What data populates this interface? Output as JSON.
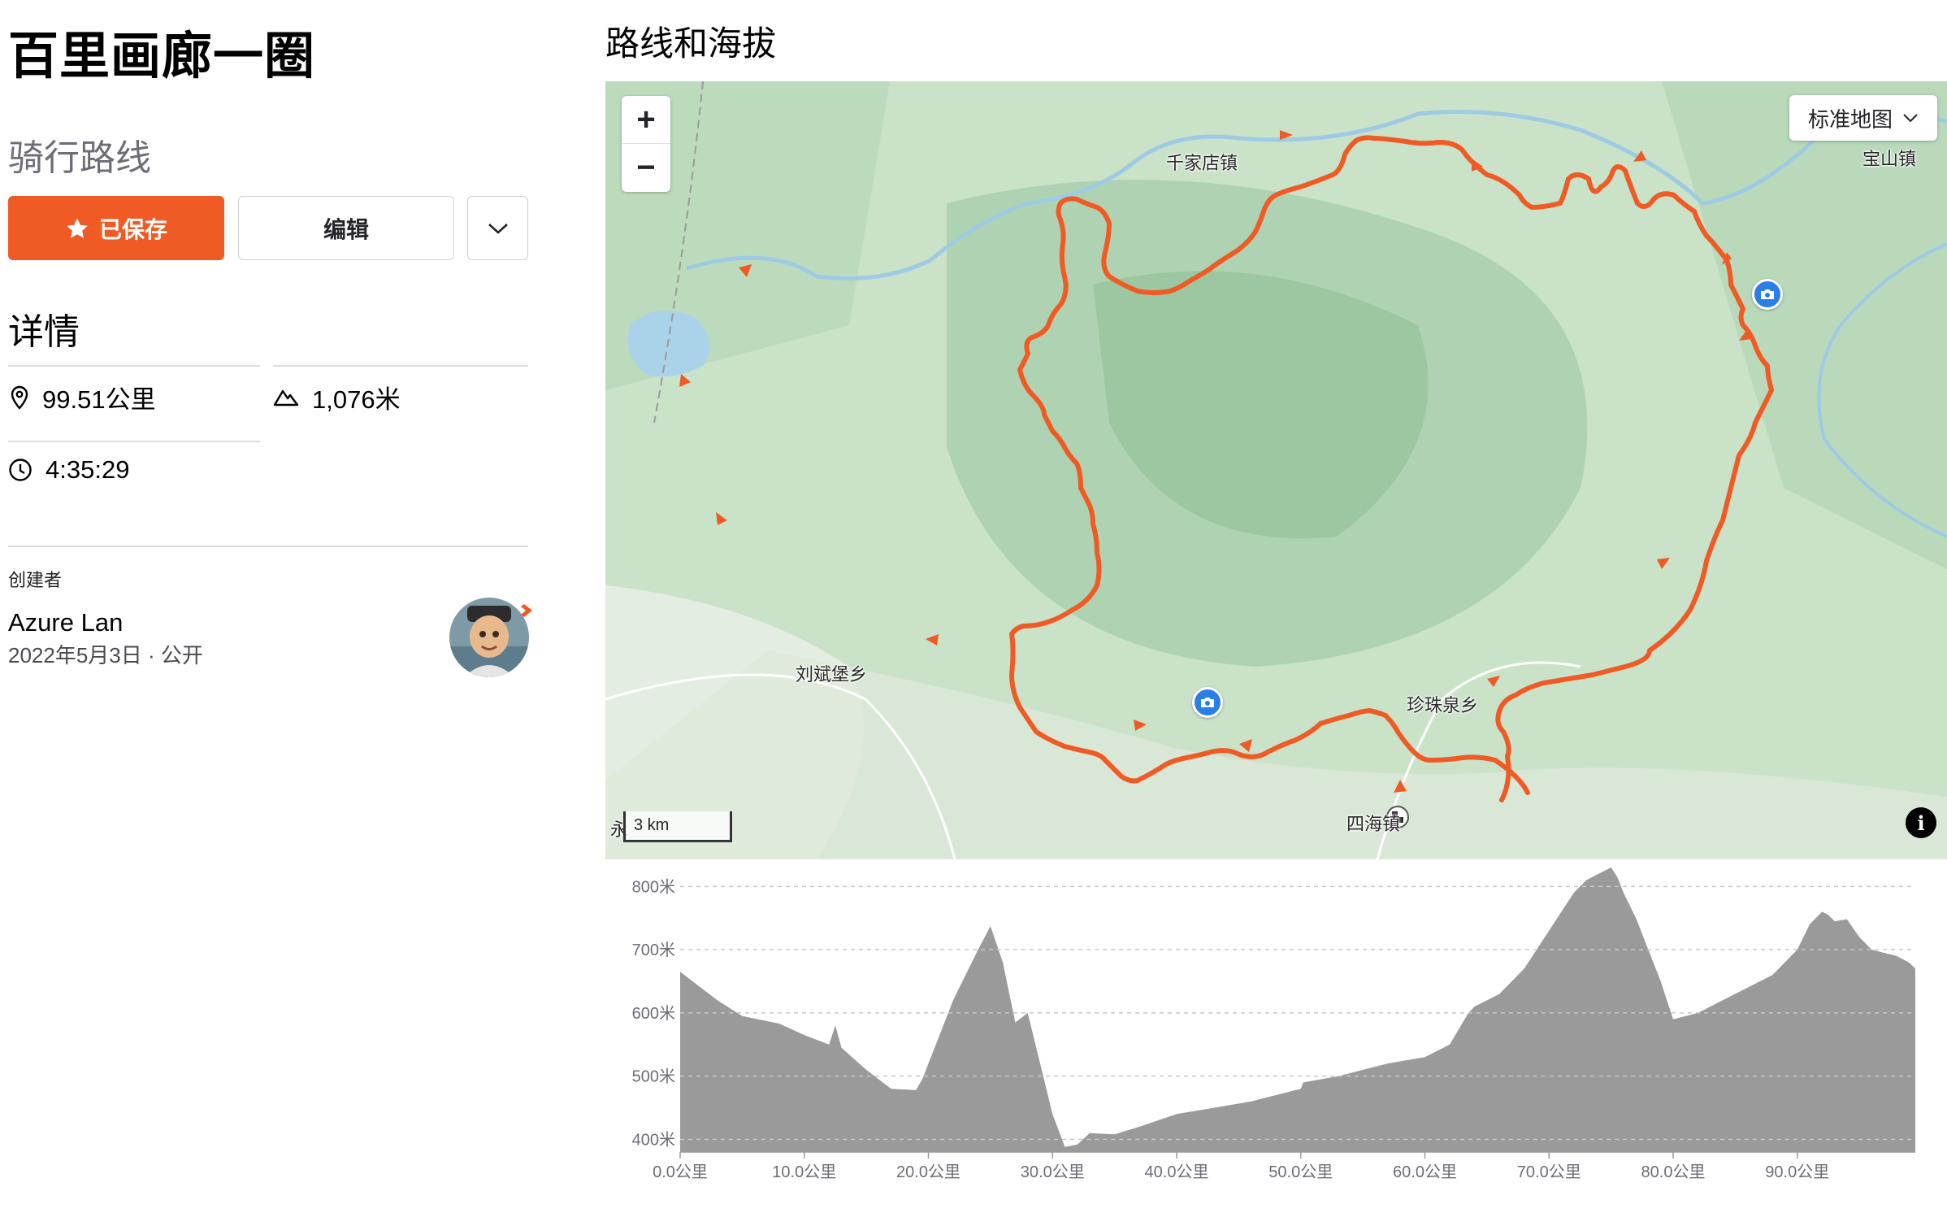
{
  "route": {
    "title": "百里画廊一圈",
    "type": "骑行路线"
  },
  "actions": {
    "saved_label": "已保存",
    "edit_label": "编辑"
  },
  "details": {
    "heading": "详情",
    "distance": "99.51公里",
    "elevation_gain": "1,076米",
    "moving_time": "4:35:29"
  },
  "creator": {
    "label": "创建者",
    "name": "Azure Lan",
    "meta": "2022年5月3日 · 公开"
  },
  "map_section": {
    "heading": "路线和海拔",
    "map_type": "标准地图",
    "scale": "3 km",
    "zoom_in": "+",
    "zoom_out": "−",
    "info": "i",
    "places": [
      "千家店镇",
      "宝山镇",
      "刘斌堡乡",
      "珍珠泉乡",
      "四海镇",
      "永"
    ]
  },
  "colors": {
    "accent": "#f05a24",
    "route": "#f05a24",
    "photo_marker": "#2a7ee8",
    "elevation_fill": "#9a9a9a"
  },
  "icons": {
    "saved": "star-icon",
    "more": "chevron-down-icon",
    "distance": "location-pin-icon",
    "elevation": "mountain-icon",
    "time": "clock-icon",
    "photo": "camera-icon",
    "finish": "checkered-flag-icon"
  },
  "chart_data": {
    "type": "area",
    "title": "",
    "xlabel": "",
    "ylabel": "",
    "x_unit": "公里",
    "y_unit": "米",
    "xlim": [
      0,
      99.51
    ],
    "ylim": [
      380,
      830
    ],
    "grid": true,
    "x_ticks": [
      "0.0公里",
      "10.0公里",
      "20.0公里",
      "30.0公里",
      "40.0公里",
      "50.0公里",
      "60.0公里",
      "70.0公里",
      "80.0公里",
      "90.0公里"
    ],
    "y_ticks": [
      "800米",
      "700米",
      "600米",
      "500米",
      "400米"
    ],
    "x": [
      0,
      1,
      3,
      5,
      8,
      10,
      12,
      12.5,
      13,
      15,
      17,
      19,
      19.5,
      20,
      21,
      22,
      24,
      25,
      26,
      27,
      28,
      29,
      30,
      31,
      32,
      33,
      35,
      37,
      40,
      43,
      46,
      50,
      50.2,
      53,
      57,
      60,
      62,
      63.5,
      64,
      66,
      68,
      69,
      71,
      72,
      73,
      74,
      75,
      75.5,
      76,
      77,
      78,
      79,
      80,
      82,
      84,
      86,
      88,
      90,
      91,
      92,
      92.5,
      93,
      94,
      95,
      96,
      98,
      99,
      99.51
    ],
    "y": [
      665,
      650,
      620,
      595,
      583,
      565,
      550,
      580,
      545,
      510,
      480,
      478,
      495,
      520,
      570,
      620,
      700,
      737,
      680,
      585,
      600,
      520,
      440,
      388,
      392,
      410,
      408,
      420,
      440,
      450,
      460,
      480,
      490,
      500,
      520,
      530,
      550,
      600,
      610,
      630,
      670,
      700,
      760,
      790,
      810,
      820,
      830,
      815,
      790,
      750,
      700,
      650,
      590,
      600,
      620,
      640,
      660,
      700,
      740,
      760,
      755,
      745,
      748,
      720,
      700,
      690,
      680,
      670
    ]
  }
}
